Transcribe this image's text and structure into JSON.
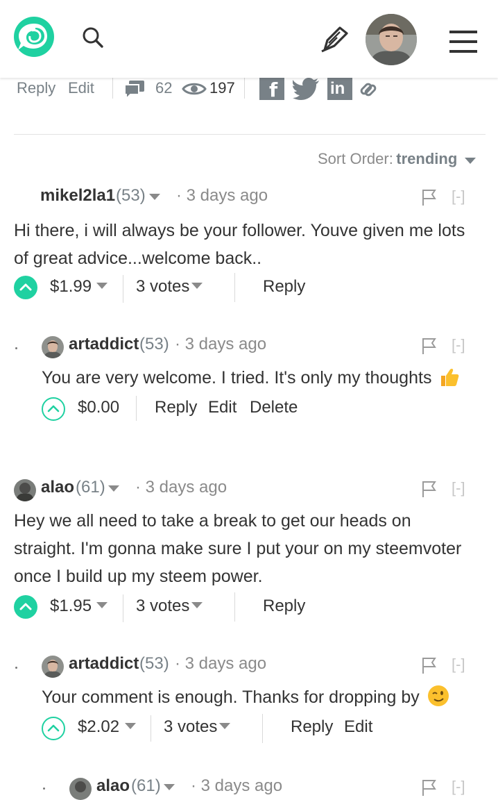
{
  "header": {
    "logo": "steemit-logo",
    "icons": [
      "search-icon",
      "pencil-icon",
      "menu-icon"
    ]
  },
  "post_bar": {
    "reply": "Reply",
    "edit": "Edit",
    "comments_count": "62",
    "views_count": "197"
  },
  "sort": {
    "label": "Sort Order:",
    "value": "trending"
  },
  "comments": [
    {
      "author": "mikel2la1",
      "rep": "(53)",
      "time": "· 3 days ago",
      "body": [
        "Hi there, i will always be your follower. Youve given me lots",
        "of great advice...welcome back.."
      ],
      "payout": "$1.99",
      "votes": "3 votes",
      "reply": "Reply",
      "collapse": "[-]"
    },
    {
      "author": "artaddict",
      "rep": "(53)",
      "time": "· 3 days ago",
      "body": [
        "You are very welcome. I tried. It's only my thoughts"
      ],
      "payout": "$0.00",
      "reply": "Reply",
      "edit": "Edit",
      "delete": "Delete",
      "collapse": "[-]"
    },
    {
      "author": "alao",
      "rep": "(61)",
      "time": "· 3 days ago",
      "body": [
        "Hey we all need to take a break to get our heads on",
        "straight. I'm gonna make sure I put your on my steemvoter",
        "once I build up my steem power."
      ],
      "payout": "$1.95",
      "votes": "3 votes",
      "reply": "Reply",
      "collapse": "[-]"
    },
    {
      "author": "artaddict",
      "rep": "(53)",
      "time": "· 3 days ago",
      "body": [
        "Your comment is enough. Thanks for dropping by"
      ],
      "payout": "$2.02",
      "votes": "3 votes",
      "reply": "Reply",
      "edit": "Edit",
      "collapse": "[-]"
    },
    {
      "author": "alao",
      "rep": "(61)",
      "time": "· 3 days ago",
      "collapse": "[-]"
    }
  ],
  "colors": {
    "accent": "#1fd1a1",
    "muted": "#788187",
    "text": "#333333"
  }
}
